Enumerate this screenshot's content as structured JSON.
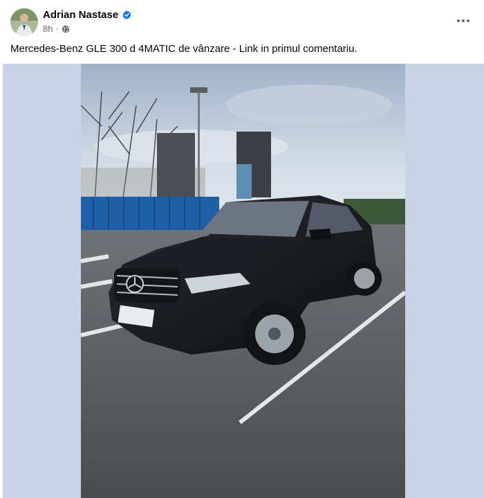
{
  "post": {
    "author_name": "Adrian Nastase",
    "timestamp": "8h",
    "separator": "·",
    "text": "Mercedes-Benz GLE 300 d 4MATIC de vânzare - Link in primul comentariu.",
    "icons": {
      "verified": "verified-badge-icon",
      "audience": "globe-icon",
      "more": "more-options-icon"
    },
    "colors": {
      "verified_blue": "#1877f2",
      "secondary_text": "#65676b",
      "media_background": "#c9d3e6"
    }
  }
}
